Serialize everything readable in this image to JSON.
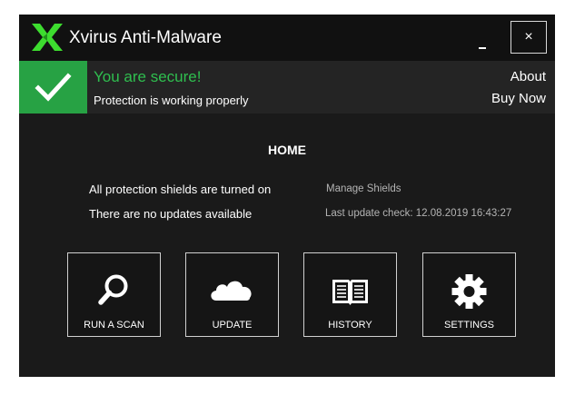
{
  "window": {
    "title": "Xvirus Anti-Malware",
    "minimize_label": "minimize",
    "close_label": "×"
  },
  "status": {
    "title": "You are secure!",
    "subtitle": "Protection is working properly",
    "about_label": "About",
    "buy_now_label": "Buy Now"
  },
  "main": {
    "heading": "HOME",
    "shields_status": "All protection shields are turned on",
    "updates_status": "There are no updates available",
    "manage_shields_label": "Manage Shields",
    "last_update_check": "Last update check: 12.08.2019 16:43:27"
  },
  "tiles": [
    {
      "label": "RUN A SCAN",
      "icon": "magnifier-icon"
    },
    {
      "label": "UPDATE",
      "icon": "cloud-icon"
    },
    {
      "label": "HISTORY",
      "icon": "book-icon"
    },
    {
      "label": "SETTINGS",
      "icon": "gear-icon"
    }
  ],
  "colors": {
    "accent_green": "#27a244",
    "status_text_green": "#2fbf4f",
    "logo_green": "#3ddc2f",
    "window_background": "#1a1a1a",
    "titlebar_background": "#111111"
  }
}
